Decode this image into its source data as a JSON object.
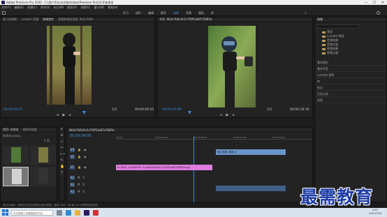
{
  "window": {
    "title": "Adobe Premiere Pro 2020 - C:\\用户\\Fulsa\\文档\\Adobe\\Premiere Pro\\14.0\\未命名",
    "minimize": "—",
    "maximize": "☐",
    "close": "✕"
  },
  "menu": [
    "文件(F)",
    "编辑(E)",
    "剪辑(C)",
    "序列(S)",
    "标记(M)",
    "图形(G)",
    "视图(V)",
    "窗口(W)",
    "帮助(H)"
  ],
  "workspaces": {
    "tabs": [
      "学习",
      "组件",
      "编辑",
      "颜色",
      "效果",
      "音频",
      "图形",
      "库"
    ],
    "active_index": 4,
    "more": "»"
  },
  "source_monitor": {
    "tabs": [
      "源:(无剪辑)",
      "Lumetri 范围",
      "效果控件",
      "音频剪辑混合器: 9b2e7b9c"
    ],
    "active_tab": 2,
    "timecode": "00:00:00:01",
    "duration": "00:00:00:01",
    "zoom": "1/2"
  },
  "program_monitor": {
    "tab": "节目: 9b2e7b9c9c2c7f4f5cb87cf38f3e",
    "timecode": "00:00:04:08",
    "zoom": "1/2",
    "duration": "00:00:18:18"
  },
  "effects_panel": {
    "title": "效果",
    "tree": [
      "预设",
      "Lumetri 预设",
      "音频效果",
      "音频过渡",
      "视频效果",
      "视频过渡"
    ],
    "sections": [
      "基本图形",
      "基本声音",
      "Lumetri 颜色",
      "库",
      "标记",
      "历史记录",
      "信息"
    ]
  },
  "project_panel": {
    "tabs": [
      "项目: 未命名",
      "媒体浏览器"
    ],
    "path": "未命名.prproj",
    "items_count": "4 项"
  },
  "timeline": {
    "sequence_tab": "9b2e7b9c9c2c7f4f5cb87cf38f3e",
    "timecode": "00:00:04:08",
    "ruler": [
      "00:00",
      "00:00:02:00",
      "00:00:04:00",
      "00:00:06:00",
      "00:00:08:00",
      "00:00:10:00",
      "00:00:12:00",
      "00:00:14:00",
      "00:00:16:00",
      "00:00:18:00"
    ],
    "tracks": [
      "V3",
      "V2",
      "V1",
      "A1",
      "A2",
      "A3"
    ],
    "clips": {
      "v2": "默认效果 (剪辑 2)",
      "v1a": "fx 9b2e7",
      "v1b": "fx 9b2e7b",
      "v1c": "fx 9b2e7b9c9c2c7f4f5cb87cf38f3e.jpg"
    },
    "colors": {
      "v2_clip": "#6a95c9",
      "v1_clip": "#e07ce0",
      "audio_clip": "#3f5f87"
    }
  },
  "tools": [
    "▸",
    "⇹",
    "◇",
    "✂",
    "⟷",
    "✎",
    "✋",
    "T"
  ],
  "status": "单击以选择，或单击空白处并拖动以进行框选。使用 Shift、Alt 和 Ctrl 可获得其他选项。",
  "taskbar": {
    "search_placeholder": "在这里输入你要搜索的内容",
    "time": "9:47",
    "date": "2021/7/20"
  },
  "watermark": "最需教育"
}
